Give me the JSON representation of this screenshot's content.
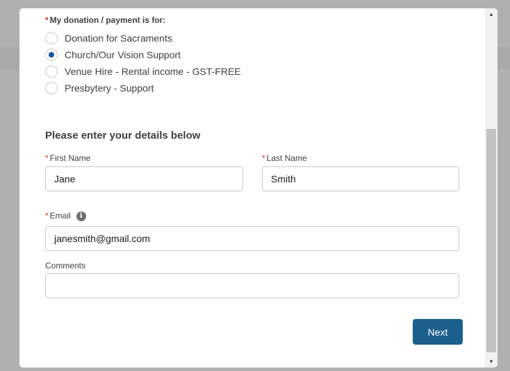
{
  "payment": {
    "label": "My donation / payment is for:",
    "options": [
      {
        "label": "Donation for Sacraments",
        "checked": false
      },
      {
        "label": "Church/Our Vision Support",
        "checked": true
      },
      {
        "label": "Venue Hire - Rental income - GST-FREE",
        "checked": false
      },
      {
        "label": "Presbytery - Support",
        "checked": false
      }
    ]
  },
  "details": {
    "title": "Please enter your details below",
    "first_name": {
      "label": "First Name",
      "value": "Jane"
    },
    "last_name": {
      "label": "Last Name",
      "value": "Smith"
    },
    "email": {
      "label": "Email",
      "value": "janesmith@gmail.com",
      "info_icon": "info-icon"
    },
    "comments": {
      "label": "Comments",
      "value": ""
    }
  },
  "required_marker": "*",
  "next_label": "Next",
  "colors": {
    "accent": "#1b5f8c",
    "radio_selected": "#1b5297",
    "required": "#c23934"
  }
}
